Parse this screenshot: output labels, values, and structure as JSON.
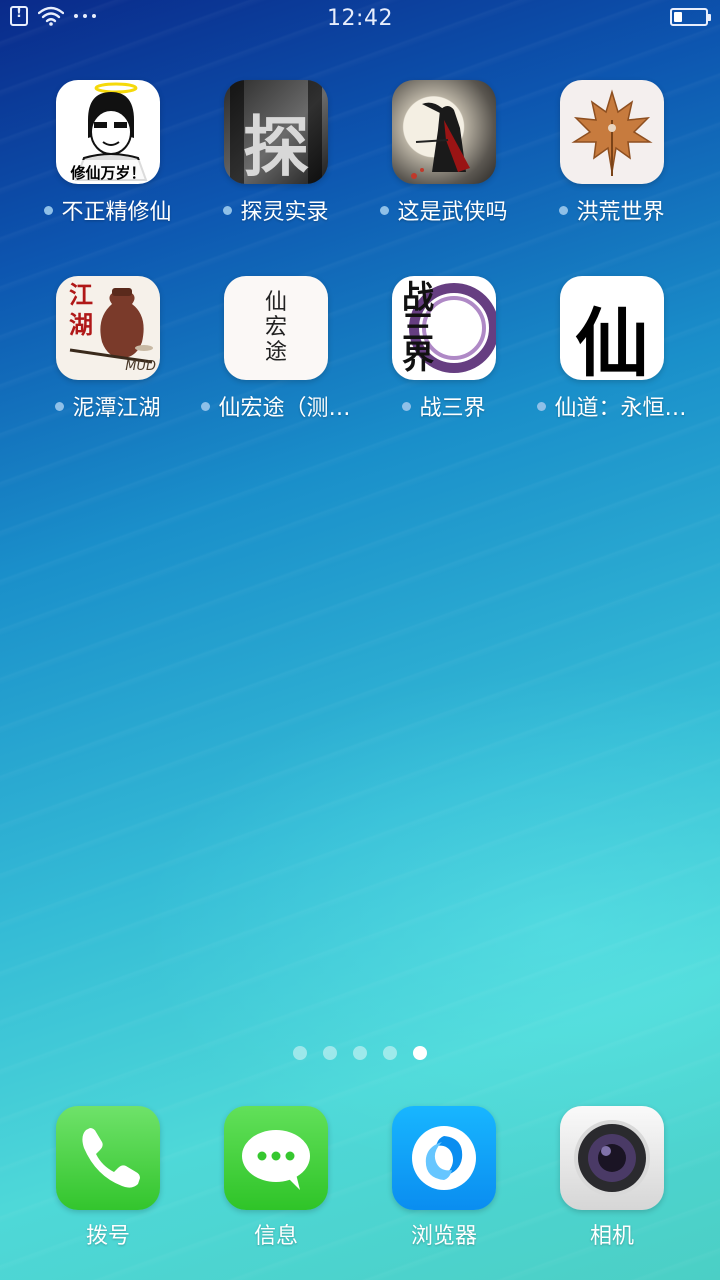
{
  "status_bar": {
    "time": "12:42",
    "icons": [
      "sim-alert-icon",
      "wifi-icon",
      "more-dots-icon",
      "battery-icon"
    ],
    "battery_level": 0.25
  },
  "apps": [
    {
      "label": "不正精修仙",
      "icon": "cartoon-face-icon",
      "icon_text": "修仙万岁！",
      "new": true
    },
    {
      "label": "探灵实录",
      "icon": "tan-character-icon",
      "icon_text": "探",
      "new": true
    },
    {
      "label": "这是武侠吗",
      "icon": "swordsman-moon-icon",
      "new": true
    },
    {
      "label": "洪荒世界",
      "icon": "maple-leaf-icon",
      "new": true
    },
    {
      "label": "泥潭江湖",
      "icon": "jianghu-jar-icon",
      "icon_text": "江湖",
      "icon_subtext": "MUD",
      "new": true
    },
    {
      "label": "仙宏途（测…",
      "icon": "xianhongtu-icon",
      "icon_text": "仙宏途",
      "new": true
    },
    {
      "label": "战三界",
      "icon": "zhansanjie-icon",
      "icon_text": "战三界",
      "new": true
    },
    {
      "label": "仙道：永恒…",
      "icon": "xian-character-icon",
      "icon_text": "仙",
      "new": true
    }
  ],
  "pager": {
    "count": 5,
    "active_index": 4
  },
  "dock": [
    {
      "label": "拨号",
      "icon": "phone-icon"
    },
    {
      "label": "信息",
      "icon": "message-icon"
    },
    {
      "label": "浏览器",
      "icon": "browser-icon"
    },
    {
      "label": "相机",
      "icon": "camera-icon"
    }
  ],
  "colors": {
    "dock_phone": "#4cd137",
    "dock_message": "#3fd43a",
    "dock_browser": "#0a9cf5",
    "dock_camera": "#e6e6e6",
    "new_dot": "#8fc0e8"
  }
}
